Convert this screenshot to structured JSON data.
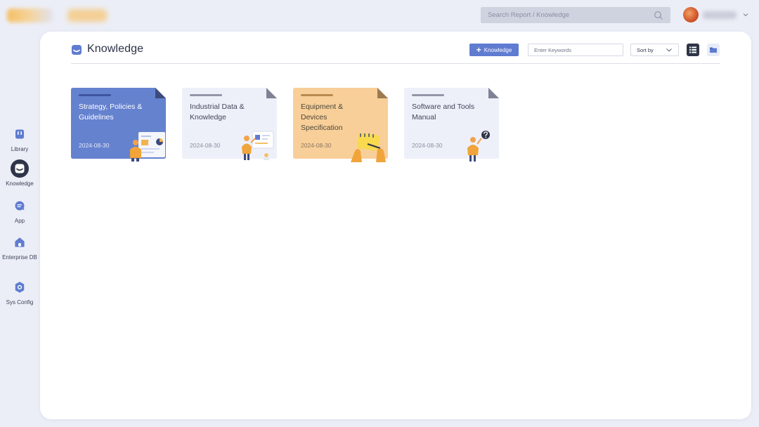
{
  "header": {
    "search_placeholder": "Search Report / Knowledge"
  },
  "sidebar": {
    "items": [
      {
        "label": "Library",
        "icon": "library-icon",
        "active": false
      },
      {
        "label": "Knowledge",
        "icon": "knowledge-icon",
        "active": true
      },
      {
        "label": "App",
        "icon": "app-icon",
        "active": false
      },
      {
        "label": "Enterprise DB",
        "icon": "enterprise-db-icon",
        "active": false
      },
      {
        "label": "Sys Config",
        "icon": "gear-icon",
        "active": false
      }
    ]
  },
  "main": {
    "title": "Knowledge",
    "add_button_label": "Knowledge",
    "keyword_placeholder": "Enter Keywords",
    "sort_label": "Sort by"
  },
  "cards": [
    {
      "title": "Strategy, Policies & Guidelines",
      "date": "2024-08-30",
      "bg": "#6582cf",
      "text": "#ffffff",
      "date_color": "#e4e9fb",
      "bar": "#3f55a0",
      "fold": "#3c4a7c"
    },
    {
      "title": "Industrial Data & Knowledge",
      "date": "2024-08-30",
      "bg": "#eef0f9",
      "text": "#404659",
      "date_color": "#8a8fa0",
      "bar": "#9296a6",
      "fold": "#7e8294"
    },
    {
      "title": "Equipment & Devices Specification",
      "date": "2024-08-30",
      "bg": "#f8cf99",
      "text": "#4d4638",
      "date_color": "#8a7660",
      "bar": "#b88a52",
      "fold": "#9c7a50"
    },
    {
      "title": "Software and Tools Manual",
      "date": "2024-08-30",
      "bg": "#eef0f9",
      "text": "#404659",
      "date_color": "#8a8fa0",
      "bar": "#9296a6",
      "fold": "#7e8294"
    }
  ],
  "colors": {
    "accent": "#5f7cd1",
    "nav_active": "#2f3548"
  }
}
